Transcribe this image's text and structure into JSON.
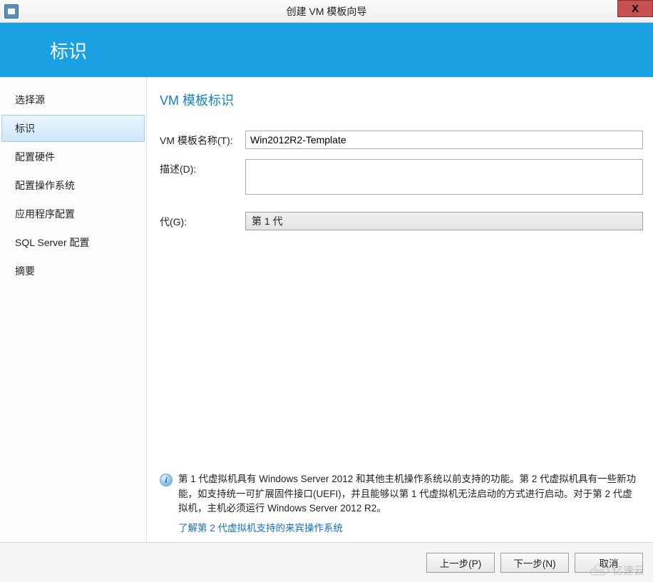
{
  "window": {
    "title": "创建 VM 模板向导",
    "close_glyph": "X"
  },
  "header": {
    "title": "标识"
  },
  "sidebar": {
    "items": [
      {
        "label": "选择源",
        "active": false
      },
      {
        "label": "标识",
        "active": true
      },
      {
        "label": "配置硬件",
        "active": false
      },
      {
        "label": "配置操作系统",
        "active": false
      },
      {
        "label": "应用程序配置",
        "active": false
      },
      {
        "label": "SQL Server 配置",
        "active": false
      },
      {
        "label": "摘要",
        "active": false
      }
    ]
  },
  "main": {
    "section_title": "VM 模板标识",
    "name_label": "VM 模板名称(T):",
    "name_value": "Win2012R2-Template",
    "desc_label": "描述(D):",
    "desc_value": "",
    "gen_label": "代(G):",
    "gen_value": "第 1 代",
    "info_icon_char": "i",
    "info_text": "第 1 代虚拟机具有 Windows Server 2012 和其他主机操作系统以前支持的功能。第 2 代虚拟机具有一些新功能，如支持统一可扩展固件接口(UEFI)，并且能够以第 1 代虚拟机无法启动的方式进行启动。对于第 2 代虚拟机，主机必须运行 Windows Server 2012 R2。",
    "info_link": "了解第 2 代虚拟机支持的来宾操作系统"
  },
  "footer": {
    "prev": "上一步(P)",
    "next": "下一步(N)",
    "cancel": "取消"
  },
  "watermark": {
    "text": "亿速云"
  }
}
